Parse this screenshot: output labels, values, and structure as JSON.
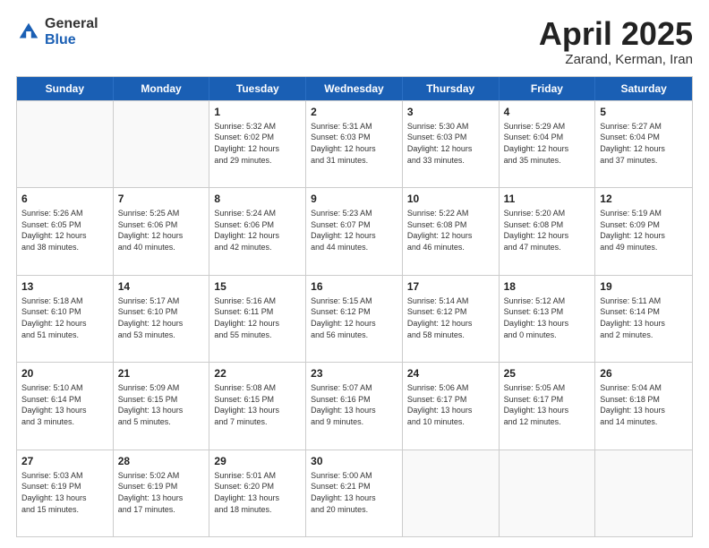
{
  "logo": {
    "general": "General",
    "blue": "Blue"
  },
  "title": {
    "month": "April 2025",
    "location": "Zarand, Kerman, Iran"
  },
  "header": {
    "days": [
      "Sunday",
      "Monday",
      "Tuesday",
      "Wednesday",
      "Thursday",
      "Friday",
      "Saturday"
    ]
  },
  "rows": [
    [
      {
        "day": "",
        "lines": []
      },
      {
        "day": "",
        "lines": []
      },
      {
        "day": "1",
        "lines": [
          "Sunrise: 5:32 AM",
          "Sunset: 6:02 PM",
          "Daylight: 12 hours",
          "and 29 minutes."
        ]
      },
      {
        "day": "2",
        "lines": [
          "Sunrise: 5:31 AM",
          "Sunset: 6:03 PM",
          "Daylight: 12 hours",
          "and 31 minutes."
        ]
      },
      {
        "day": "3",
        "lines": [
          "Sunrise: 5:30 AM",
          "Sunset: 6:03 PM",
          "Daylight: 12 hours",
          "and 33 minutes."
        ]
      },
      {
        "day": "4",
        "lines": [
          "Sunrise: 5:29 AM",
          "Sunset: 6:04 PM",
          "Daylight: 12 hours",
          "and 35 minutes."
        ]
      },
      {
        "day": "5",
        "lines": [
          "Sunrise: 5:27 AM",
          "Sunset: 6:04 PM",
          "Daylight: 12 hours",
          "and 37 minutes."
        ]
      }
    ],
    [
      {
        "day": "6",
        "lines": [
          "Sunrise: 5:26 AM",
          "Sunset: 6:05 PM",
          "Daylight: 12 hours",
          "and 38 minutes."
        ]
      },
      {
        "day": "7",
        "lines": [
          "Sunrise: 5:25 AM",
          "Sunset: 6:06 PM",
          "Daylight: 12 hours",
          "and 40 minutes."
        ]
      },
      {
        "day": "8",
        "lines": [
          "Sunrise: 5:24 AM",
          "Sunset: 6:06 PM",
          "Daylight: 12 hours",
          "and 42 minutes."
        ]
      },
      {
        "day": "9",
        "lines": [
          "Sunrise: 5:23 AM",
          "Sunset: 6:07 PM",
          "Daylight: 12 hours",
          "and 44 minutes."
        ]
      },
      {
        "day": "10",
        "lines": [
          "Sunrise: 5:22 AM",
          "Sunset: 6:08 PM",
          "Daylight: 12 hours",
          "and 46 minutes."
        ]
      },
      {
        "day": "11",
        "lines": [
          "Sunrise: 5:20 AM",
          "Sunset: 6:08 PM",
          "Daylight: 12 hours",
          "and 47 minutes."
        ]
      },
      {
        "day": "12",
        "lines": [
          "Sunrise: 5:19 AM",
          "Sunset: 6:09 PM",
          "Daylight: 12 hours",
          "and 49 minutes."
        ]
      }
    ],
    [
      {
        "day": "13",
        "lines": [
          "Sunrise: 5:18 AM",
          "Sunset: 6:10 PM",
          "Daylight: 12 hours",
          "and 51 minutes."
        ]
      },
      {
        "day": "14",
        "lines": [
          "Sunrise: 5:17 AM",
          "Sunset: 6:10 PM",
          "Daylight: 12 hours",
          "and 53 minutes."
        ]
      },
      {
        "day": "15",
        "lines": [
          "Sunrise: 5:16 AM",
          "Sunset: 6:11 PM",
          "Daylight: 12 hours",
          "and 55 minutes."
        ]
      },
      {
        "day": "16",
        "lines": [
          "Sunrise: 5:15 AM",
          "Sunset: 6:12 PM",
          "Daylight: 12 hours",
          "and 56 minutes."
        ]
      },
      {
        "day": "17",
        "lines": [
          "Sunrise: 5:14 AM",
          "Sunset: 6:12 PM",
          "Daylight: 12 hours",
          "and 58 minutes."
        ]
      },
      {
        "day": "18",
        "lines": [
          "Sunrise: 5:12 AM",
          "Sunset: 6:13 PM",
          "Daylight: 13 hours",
          "and 0 minutes."
        ]
      },
      {
        "day": "19",
        "lines": [
          "Sunrise: 5:11 AM",
          "Sunset: 6:14 PM",
          "Daylight: 13 hours",
          "and 2 minutes."
        ]
      }
    ],
    [
      {
        "day": "20",
        "lines": [
          "Sunrise: 5:10 AM",
          "Sunset: 6:14 PM",
          "Daylight: 13 hours",
          "and 3 minutes."
        ]
      },
      {
        "day": "21",
        "lines": [
          "Sunrise: 5:09 AM",
          "Sunset: 6:15 PM",
          "Daylight: 13 hours",
          "and 5 minutes."
        ]
      },
      {
        "day": "22",
        "lines": [
          "Sunrise: 5:08 AM",
          "Sunset: 6:15 PM",
          "Daylight: 13 hours",
          "and 7 minutes."
        ]
      },
      {
        "day": "23",
        "lines": [
          "Sunrise: 5:07 AM",
          "Sunset: 6:16 PM",
          "Daylight: 13 hours",
          "and 9 minutes."
        ]
      },
      {
        "day": "24",
        "lines": [
          "Sunrise: 5:06 AM",
          "Sunset: 6:17 PM",
          "Daylight: 13 hours",
          "and 10 minutes."
        ]
      },
      {
        "day": "25",
        "lines": [
          "Sunrise: 5:05 AM",
          "Sunset: 6:17 PM",
          "Daylight: 13 hours",
          "and 12 minutes."
        ]
      },
      {
        "day": "26",
        "lines": [
          "Sunrise: 5:04 AM",
          "Sunset: 6:18 PM",
          "Daylight: 13 hours",
          "and 14 minutes."
        ]
      }
    ],
    [
      {
        "day": "27",
        "lines": [
          "Sunrise: 5:03 AM",
          "Sunset: 6:19 PM",
          "Daylight: 13 hours",
          "and 15 minutes."
        ]
      },
      {
        "day": "28",
        "lines": [
          "Sunrise: 5:02 AM",
          "Sunset: 6:19 PM",
          "Daylight: 13 hours",
          "and 17 minutes."
        ]
      },
      {
        "day": "29",
        "lines": [
          "Sunrise: 5:01 AM",
          "Sunset: 6:20 PM",
          "Daylight: 13 hours",
          "and 18 minutes."
        ]
      },
      {
        "day": "30",
        "lines": [
          "Sunrise: 5:00 AM",
          "Sunset: 6:21 PM",
          "Daylight: 13 hours",
          "and 20 minutes."
        ]
      },
      {
        "day": "",
        "lines": []
      },
      {
        "day": "",
        "lines": []
      },
      {
        "day": "",
        "lines": []
      }
    ]
  ]
}
